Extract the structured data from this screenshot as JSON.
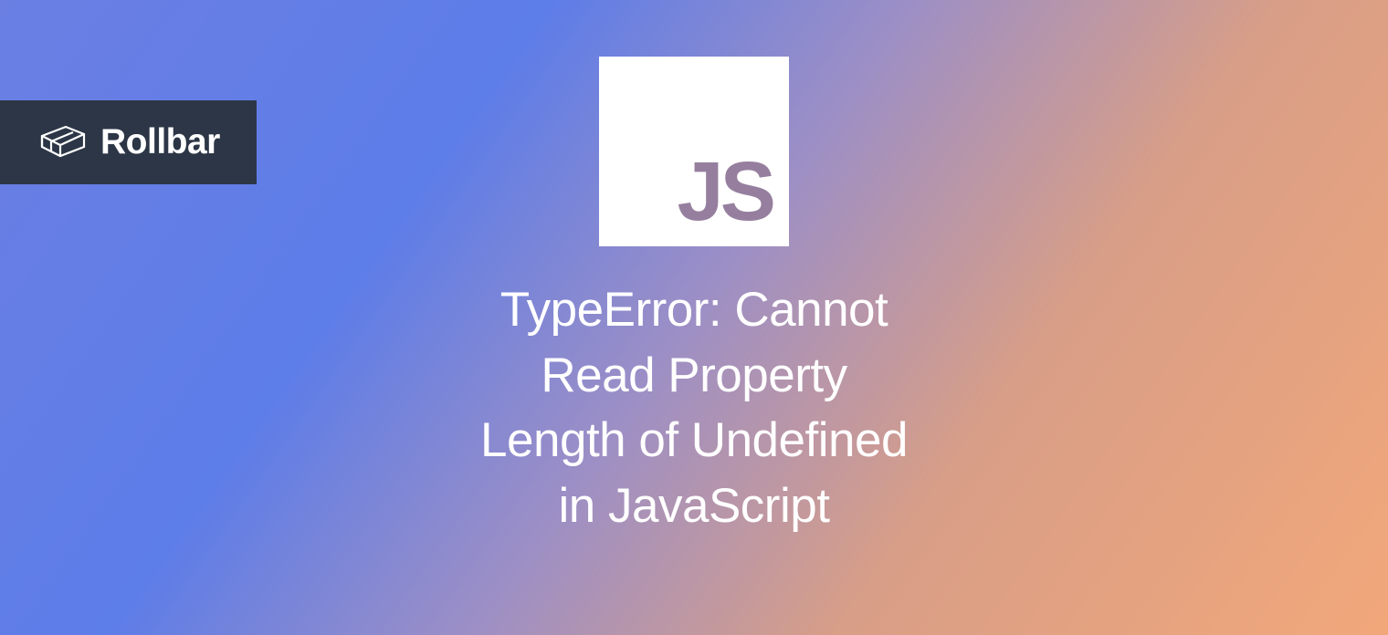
{
  "brand": {
    "name": "Rollbar"
  },
  "tile": {
    "label": "JS"
  },
  "heading": {
    "line1": "TypeError: Cannot",
    "line2": "Read Property",
    "line3": "Length of Undefined",
    "line4": "in JavaScript"
  }
}
